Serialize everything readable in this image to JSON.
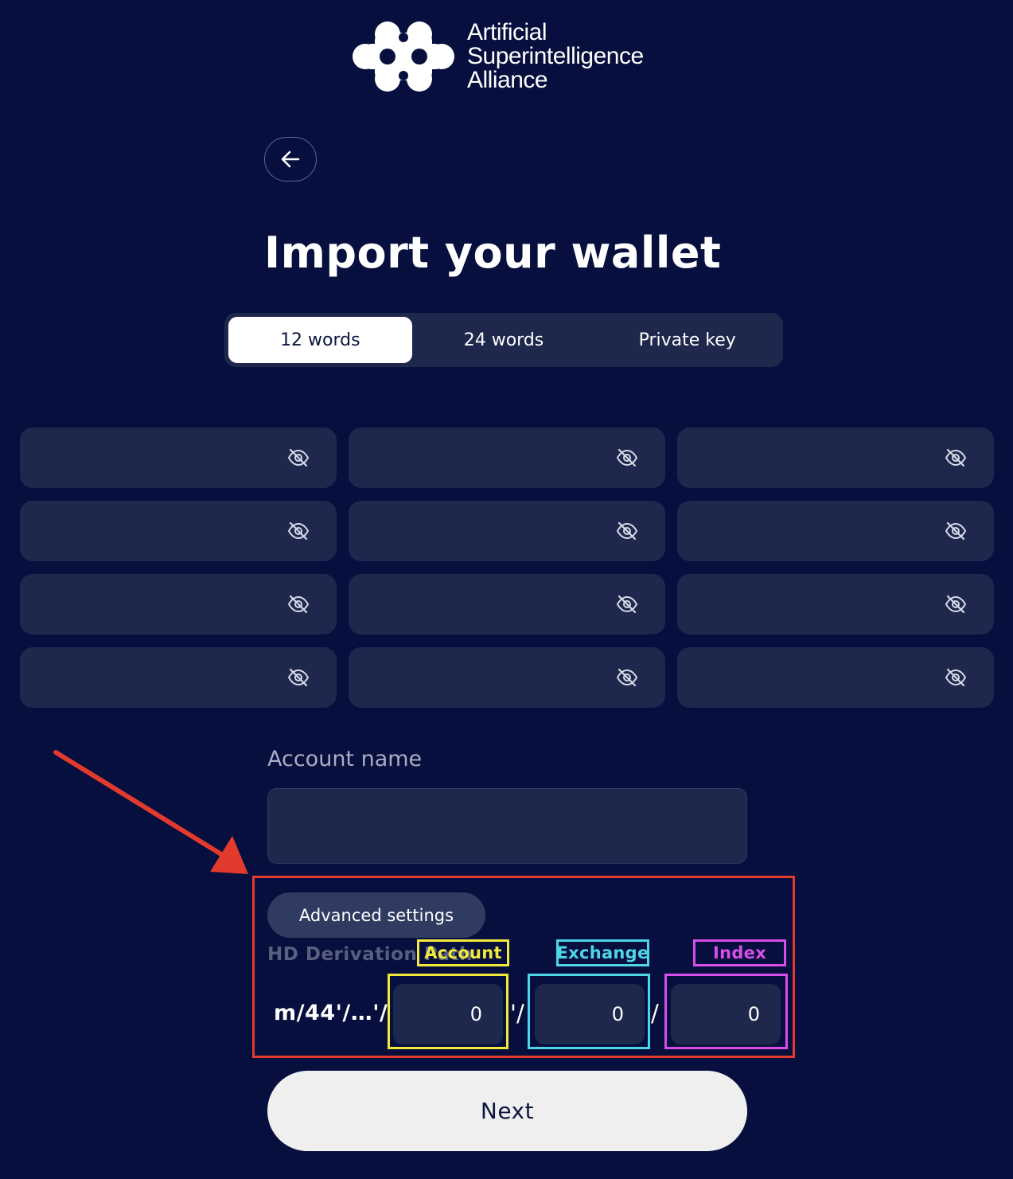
{
  "brand": {
    "line1": "Artificial",
    "line2": "Superintelligence",
    "line3": "Alliance"
  },
  "page_title": "Import your wallet",
  "tabs": [
    {
      "label": "12 words",
      "active": true
    },
    {
      "label": "24 words",
      "active": false
    },
    {
      "label": "Private key",
      "active": false
    }
  ],
  "word_fields_count": 12,
  "account": {
    "label": "Account name",
    "value": ""
  },
  "advanced_settings_label": "Advanced settings",
  "derivation": {
    "label": "HD Derivation Path",
    "prefix": "m/44'/…'/",
    "sep1": "'/",
    "sep2": "/",
    "account_value": "0",
    "exchange_value": "0",
    "index_value": "0"
  },
  "annotations": {
    "account": "Account",
    "exchange": "Exchange",
    "index": "Index",
    "colors": {
      "red": "#e23b2e",
      "yellow": "#f2e93a",
      "cyan": "#4fd5e8",
      "magenta": "#d84ee8"
    }
  },
  "next_label": "Next",
  "colors": {
    "background": "#060f3d",
    "field": "#1e284d",
    "button_light": "#efefef"
  }
}
